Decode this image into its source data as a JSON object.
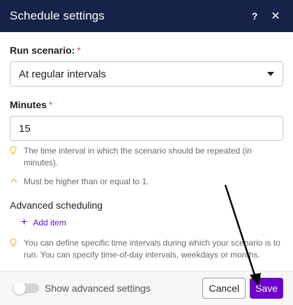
{
  "header": {
    "title": "Schedule settings",
    "help_label": "?",
    "close_label": "✕"
  },
  "run_scenario": {
    "label": "Run scenario:",
    "required_mark": "*",
    "value": "At regular intervals"
  },
  "minutes": {
    "label": "Minutes",
    "required_mark": "*",
    "value": "15",
    "hint": "The time interval in which the scenario should be repeated (in minutes).",
    "validation": "Must be higher than or equal to 1."
  },
  "advanced": {
    "title": "Advanced scheduling",
    "add_item_label": "Add item",
    "hint": "You can define specific time intervals during which your scenario is to run. You can specify time-of-day intervals, weekdays or months."
  },
  "footer": {
    "toggle_label": "Show advanced settings",
    "toggle_on": false,
    "cancel_label": "Cancel",
    "save_label": "Save"
  },
  "colors": {
    "header_bg": "#162247",
    "accent": "#6d00cc",
    "required": "#e5484d",
    "hint_icon": "#f0b429"
  },
  "icons": [
    "help-icon",
    "close-icon",
    "caret-down-icon",
    "lightbulb-icon",
    "chevron-up-icon",
    "plus-icon",
    "arrow-pointer-icon"
  ]
}
